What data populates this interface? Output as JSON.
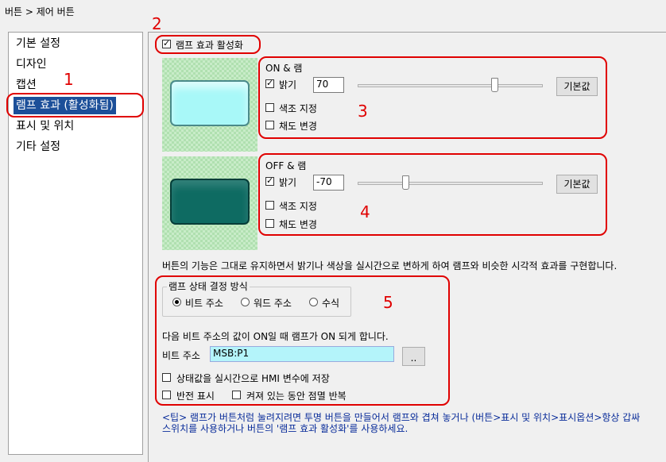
{
  "window": {
    "breadcrumb": "버튼 > 제어 버튼"
  },
  "sidebar": {
    "items": [
      {
        "label": "기본 설정"
      },
      {
        "label": "디자인"
      },
      {
        "label": "캡션"
      },
      {
        "label": "램프 효과 (활성화됨)",
        "selected": true
      },
      {
        "label": "표시 및 위치"
      },
      {
        "label": "기타 설정"
      }
    ]
  },
  "lamp": {
    "enable_label": "램프 효과 활성화",
    "enable_checked": true,
    "on": {
      "title": "ON & 램",
      "brightness_label": "밝기",
      "brightness_checked": true,
      "brightness_value": "70",
      "slider_fraction": 0.74,
      "default_button": "기본값",
      "hue_label": "색조 지정",
      "hue_checked": false,
      "saturation_label": "채도 변경",
      "saturation_checked": false,
      "preview_color": "#a8f8f8"
    },
    "off": {
      "title": "OFF & 램",
      "brightness_label": "밝기",
      "brightness_checked": true,
      "brightness_value": "-70",
      "slider_fraction": 0.26,
      "default_button": "기본값",
      "hue_label": "색조 지정",
      "hue_checked": false,
      "saturation_label": "채도 변경",
      "saturation_checked": false,
      "preview_color": "#0e6b62"
    },
    "description": "버튼의 기능은 그대로 유지하면서 밝기나 색상을 실시간으로 변하게 하여 램프와 비슷한 시각적 효과를 구현합니다.",
    "state": {
      "group_title": "램프 상태 결정 방식",
      "options": [
        "비트 주소",
        "워드 주소",
        "수식"
      ],
      "selected_index": 0,
      "info": "다음 비트 주소의 값이 ON일 때 램프가 ON 되게 합니다.",
      "address_label": "비트 주소",
      "address_value": "MSB:P1",
      "browse_button": "..",
      "save_label": "상태값을 실시간으로 HMI 변수에 저장",
      "invert_label": "반전 표시",
      "blink_label": "켜져 있는 동안 점멸 반복"
    },
    "tip_line1": "<팁> 램프가 버튼처럼 눌려지려면 투명 버튼을 만들어서 램프와 겹쳐 놓거나 (버튼>표시 및 위치>표시옵션>항상 갑싸",
    "tip_line2": "스위치를 사용하거나 버튼의 '램프 효과 활성화'를 사용하세요."
  },
  "annotations": [
    "1",
    "2",
    "3",
    "4",
    "5"
  ],
  "colors": {
    "highlight_red": "#e00000",
    "selection_blue": "#1c4f99",
    "tip_blue": "#0a2d9a"
  }
}
